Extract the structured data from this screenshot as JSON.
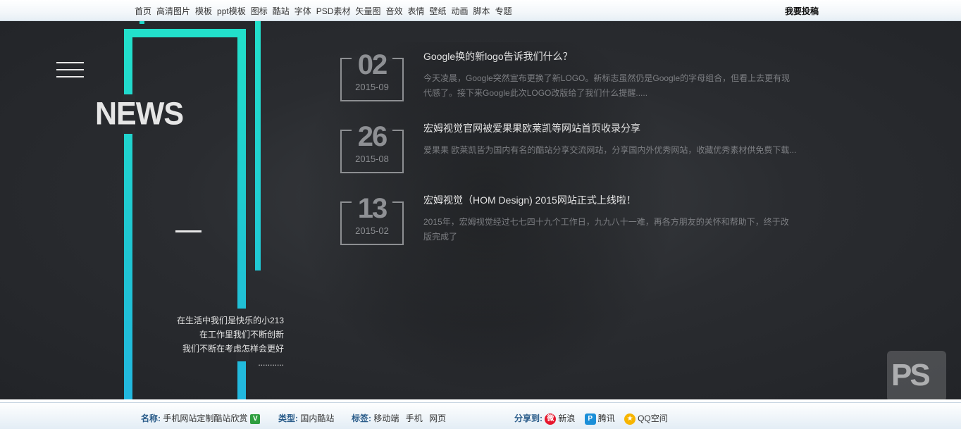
{
  "nav": {
    "items": [
      "首页",
      "高清图片",
      "模板",
      "ppt模板",
      "图标",
      "酷站",
      "字体",
      "PSD素材",
      "矢量图",
      "音效",
      "表情",
      "壁纸",
      "动画",
      "脚本",
      "专题"
    ],
    "submit_label": "我要投稿"
  },
  "hero": {
    "title": "NEWS",
    "slogan": [
      "在生活中我们是快乐的小213",
      "在工作里我们不断创新",
      "我们不断在考虑怎样会更好",
      "..........."
    ]
  },
  "news": [
    {
      "day": "02",
      "ym": "2015-09",
      "title": "Google换的新logo告诉我们什么？",
      "desc": "今天凌晨，Google突然宣布更换了新LOGO。新标志虽然仍是Google的字母组合，但看上去更有现代感了。接下来Google此次LOGO改版给了我们什么提醒....."
    },
    {
      "day": "26",
      "ym": "2015-08",
      "title": "宏姆视觉官网被爱果果欧莱凯等网站首页收录分享",
      "desc": "爱果果 欧莱凯皆为国内有名的酷站分享交流网站，分享国内外优秀网站，收藏优秀素材供免费下载..."
    },
    {
      "day": "13",
      "ym": "2015-02",
      "title": "宏姆视觉（HOM Design) 2015网站正式上线啦！",
      "desc": "2015年，宏姆视觉经过七七四十九个工作日，九九八十一难，再各方朋友的关怀和帮助下，终于改版完成了"
    }
  ],
  "watermark": "PS",
  "footer": {
    "name_label": "名称:",
    "name_value": "手机网站定制酷站欣赏",
    "verified_icon": "V",
    "type_label": "类型:",
    "type_value": "国内酷站",
    "tags_label": "标签:",
    "tags": [
      "移动端",
      "手机",
      "网页"
    ],
    "share_label": "分享到:",
    "share": [
      "新浪",
      "腾讯",
      "QQ空间"
    ]
  },
  "colors": {
    "accent": "#1fd1c7",
    "dark_bg": "#2a2c30"
  }
}
